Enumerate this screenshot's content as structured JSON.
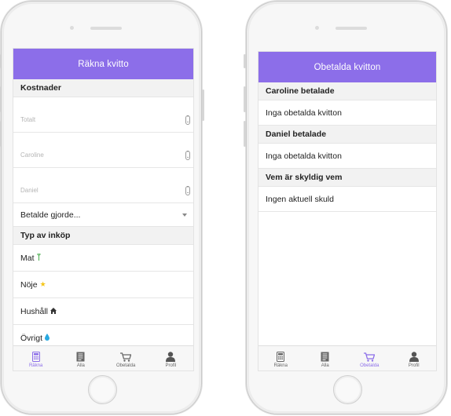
{
  "colors": {
    "accent": "#8c6ee9",
    "section_bg": "#f2f2f2"
  },
  "left_screen": {
    "title": "Räkna kvitto",
    "costs_header": "Kostnader",
    "total_placeholder": "Totalt",
    "caroline_placeholder": "Caroline",
    "daniel_placeholder": "Daniel",
    "paid_by_select": "Betalde gjorde...",
    "purchase_type_header": "Typ av inköp",
    "categories": [
      {
        "label": "Mat",
        "icon": "leaf-icon"
      },
      {
        "label": "Nöje",
        "icon": "star-icon"
      },
      {
        "label": "Hushåll",
        "icon": "house-icon"
      },
      {
        "label": "Övrigt",
        "icon": "drop-icon"
      }
    ]
  },
  "right_screen": {
    "title": "Obetalda kvitton",
    "sections": [
      {
        "header": "Caroline betalade",
        "text": "Inga obetalda kvitton"
      },
      {
        "header": "Daniel betalade",
        "text": "Inga obetalda kvitton"
      },
      {
        "header": "Vem är skyldig vem",
        "text": "Ingen aktuell skuld"
      }
    ]
  },
  "tabs": [
    {
      "label": "Räkna",
      "icon": "calculator-icon"
    },
    {
      "label": "Alla",
      "icon": "document-icon"
    },
    {
      "label": "Obetalda",
      "icon": "cart-icon"
    },
    {
      "label": "Profil",
      "icon": "person-icon"
    }
  ],
  "active_tab": {
    "left": "Räkna",
    "right": "Obetalda"
  }
}
